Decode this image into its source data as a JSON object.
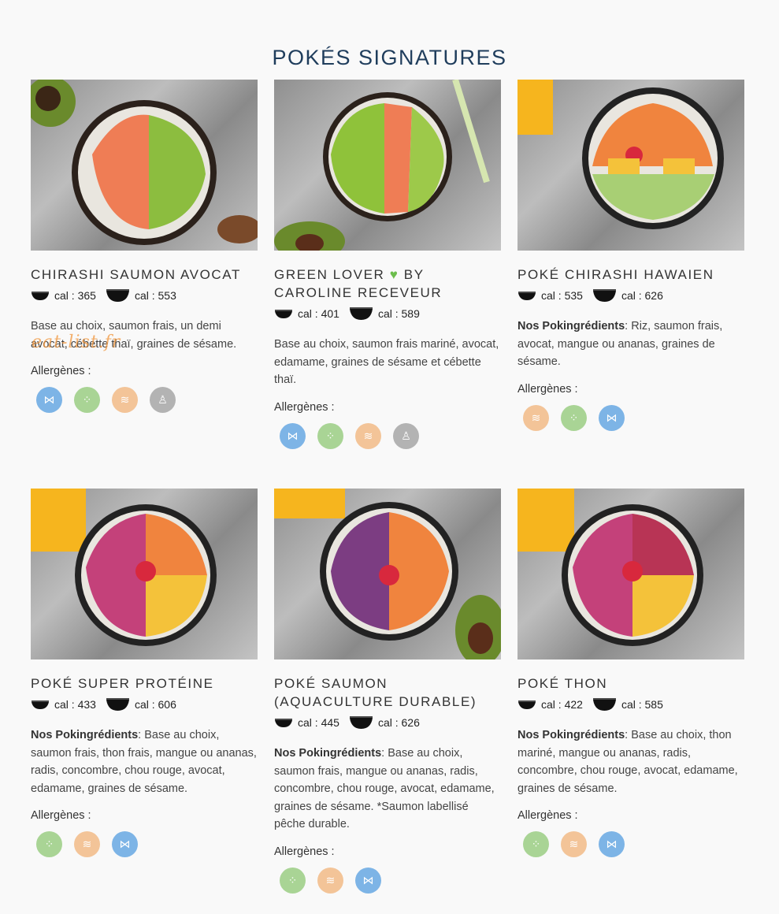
{
  "page": {
    "title": "POKÉS SIGNATURES",
    "watermark": "eat-list.fr"
  },
  "colors": {
    "fish": "#7db4e6",
    "soy": "#a9d495",
    "gluten": "#f3c498",
    "sesame": "#b3b3b3"
  },
  "cal_prefix": "cal : ",
  "allergen_label": "Allergènes :",
  "cards": [
    {
      "name": "CHIRASHI SAUMON AVOCAT",
      "cal_small": "365",
      "cal_large": "553",
      "desc_prefix": "",
      "desc": "Base au choix, saumon frais, un demi avocat, cébette thaï, graines de sésame.",
      "allergens": [
        "fish-icon",
        "soy-icon",
        "gluten-icon",
        "sesame-icon"
      ]
    },
    {
      "name": "GREEN LOVER",
      "name_suffix": "BY CAROLINE RECEVEUR",
      "cal_small": "401",
      "cal_large": "589",
      "desc_prefix": "",
      "desc": "Base au choix, saumon frais mariné, avocat, edamame, graines de sésame et cébette thaï.",
      "allergens": [
        "fish-icon",
        "soy-icon",
        "gluten-icon",
        "sesame-icon"
      ]
    },
    {
      "name": "POKÉ CHIRASHI HAWAIEN",
      "cal_small": "535",
      "cal_large": "626",
      "desc_prefix": "Nos Pokingrédients",
      "desc": ": Riz, saumon frais, avocat, mangue ou ananas, graines de sésame.",
      "allergens": [
        "gluten-icon",
        "soy-icon",
        "fish-icon"
      ]
    },
    {
      "name": "POKÉ SUPER PROTÉINE",
      "cal_small": "433",
      "cal_large": "606",
      "desc_prefix": "Nos Pokingrédients",
      "desc": ": Base au choix, saumon frais, thon frais, mangue ou ananas, radis, concombre, chou rouge, avocat, edamame, graines de sésame.",
      "allergens": [
        "soy-icon",
        "gluten-icon",
        "fish-icon"
      ]
    },
    {
      "name": "POKÉ SAUMON (AQUACULTURE DURABLE)",
      "cal_small": "445",
      "cal_large": "626",
      "desc_prefix": "Nos Pokingrédients",
      "desc": ": Base au choix, saumon frais, mangue ou ananas, radis, concombre, chou rouge, avocat, edamame, graines de sésame. *Saumon labellisé pêche durable.",
      "allergens": [
        "soy-icon",
        "gluten-icon",
        "fish-icon"
      ]
    },
    {
      "name": "POKÉ THON",
      "cal_small": "422",
      "cal_large": "585",
      "desc_prefix": "Nos Pokingrédients",
      "desc": ": Base au choix, thon mariné, mangue ou ananas, radis, concombre, chou rouge, avocat, edamame, graines de sésame.",
      "allergens": [
        "soy-icon",
        "gluten-icon",
        "fish-icon"
      ]
    }
  ]
}
